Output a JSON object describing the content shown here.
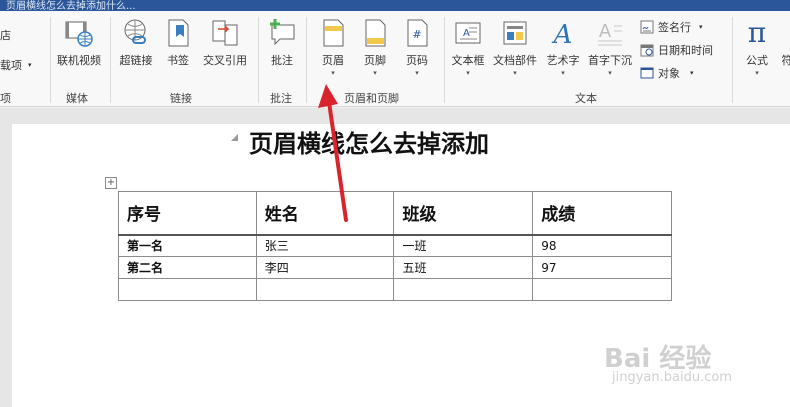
{
  "titlebar": {
    "text": "页眉横线怎么去掉添加什么..."
  },
  "ribbon": {
    "left_partial": {
      "store": "店",
      "addins": "载项",
      "addins_group": "项"
    },
    "media": {
      "online_video": "联机视频",
      "group": "媒体"
    },
    "links": {
      "hyperlink": "超链接",
      "bookmark": "书签",
      "crossref": "交叉引用",
      "group": "链接"
    },
    "comments": {
      "comment": "批注",
      "group": "批注"
    },
    "header_footer": {
      "header": "页眉",
      "footer": "页脚",
      "page_number": "页码",
      "group": "页眉和页脚"
    },
    "text": {
      "textbox": "文本框",
      "quickparts": "文档部件",
      "wordart": "艺术字",
      "dropcap": "首字下沉",
      "signature": "签名行",
      "datetime": "日期和时间",
      "object": "对象",
      "group": "文本"
    },
    "symbols": {
      "equation": "公式",
      "equation_symbol": "π",
      "partial_next": "符"
    }
  },
  "document": {
    "heading": "页眉横线怎么去掉添加",
    "table": {
      "headers": [
        "序号",
        "姓名",
        "班级",
        "成绩"
      ],
      "rows": [
        [
          "第一名",
          "张三",
          "一班",
          "98"
        ],
        [
          "第二名",
          "李四",
          "五班",
          "97"
        ]
      ]
    }
  },
  "watermark": {
    "brand": "Bai 经验",
    "url": "jingyan.baidu.com"
  },
  "colors": {
    "accent": "#2b579a",
    "arrow": "#d9232d"
  }
}
